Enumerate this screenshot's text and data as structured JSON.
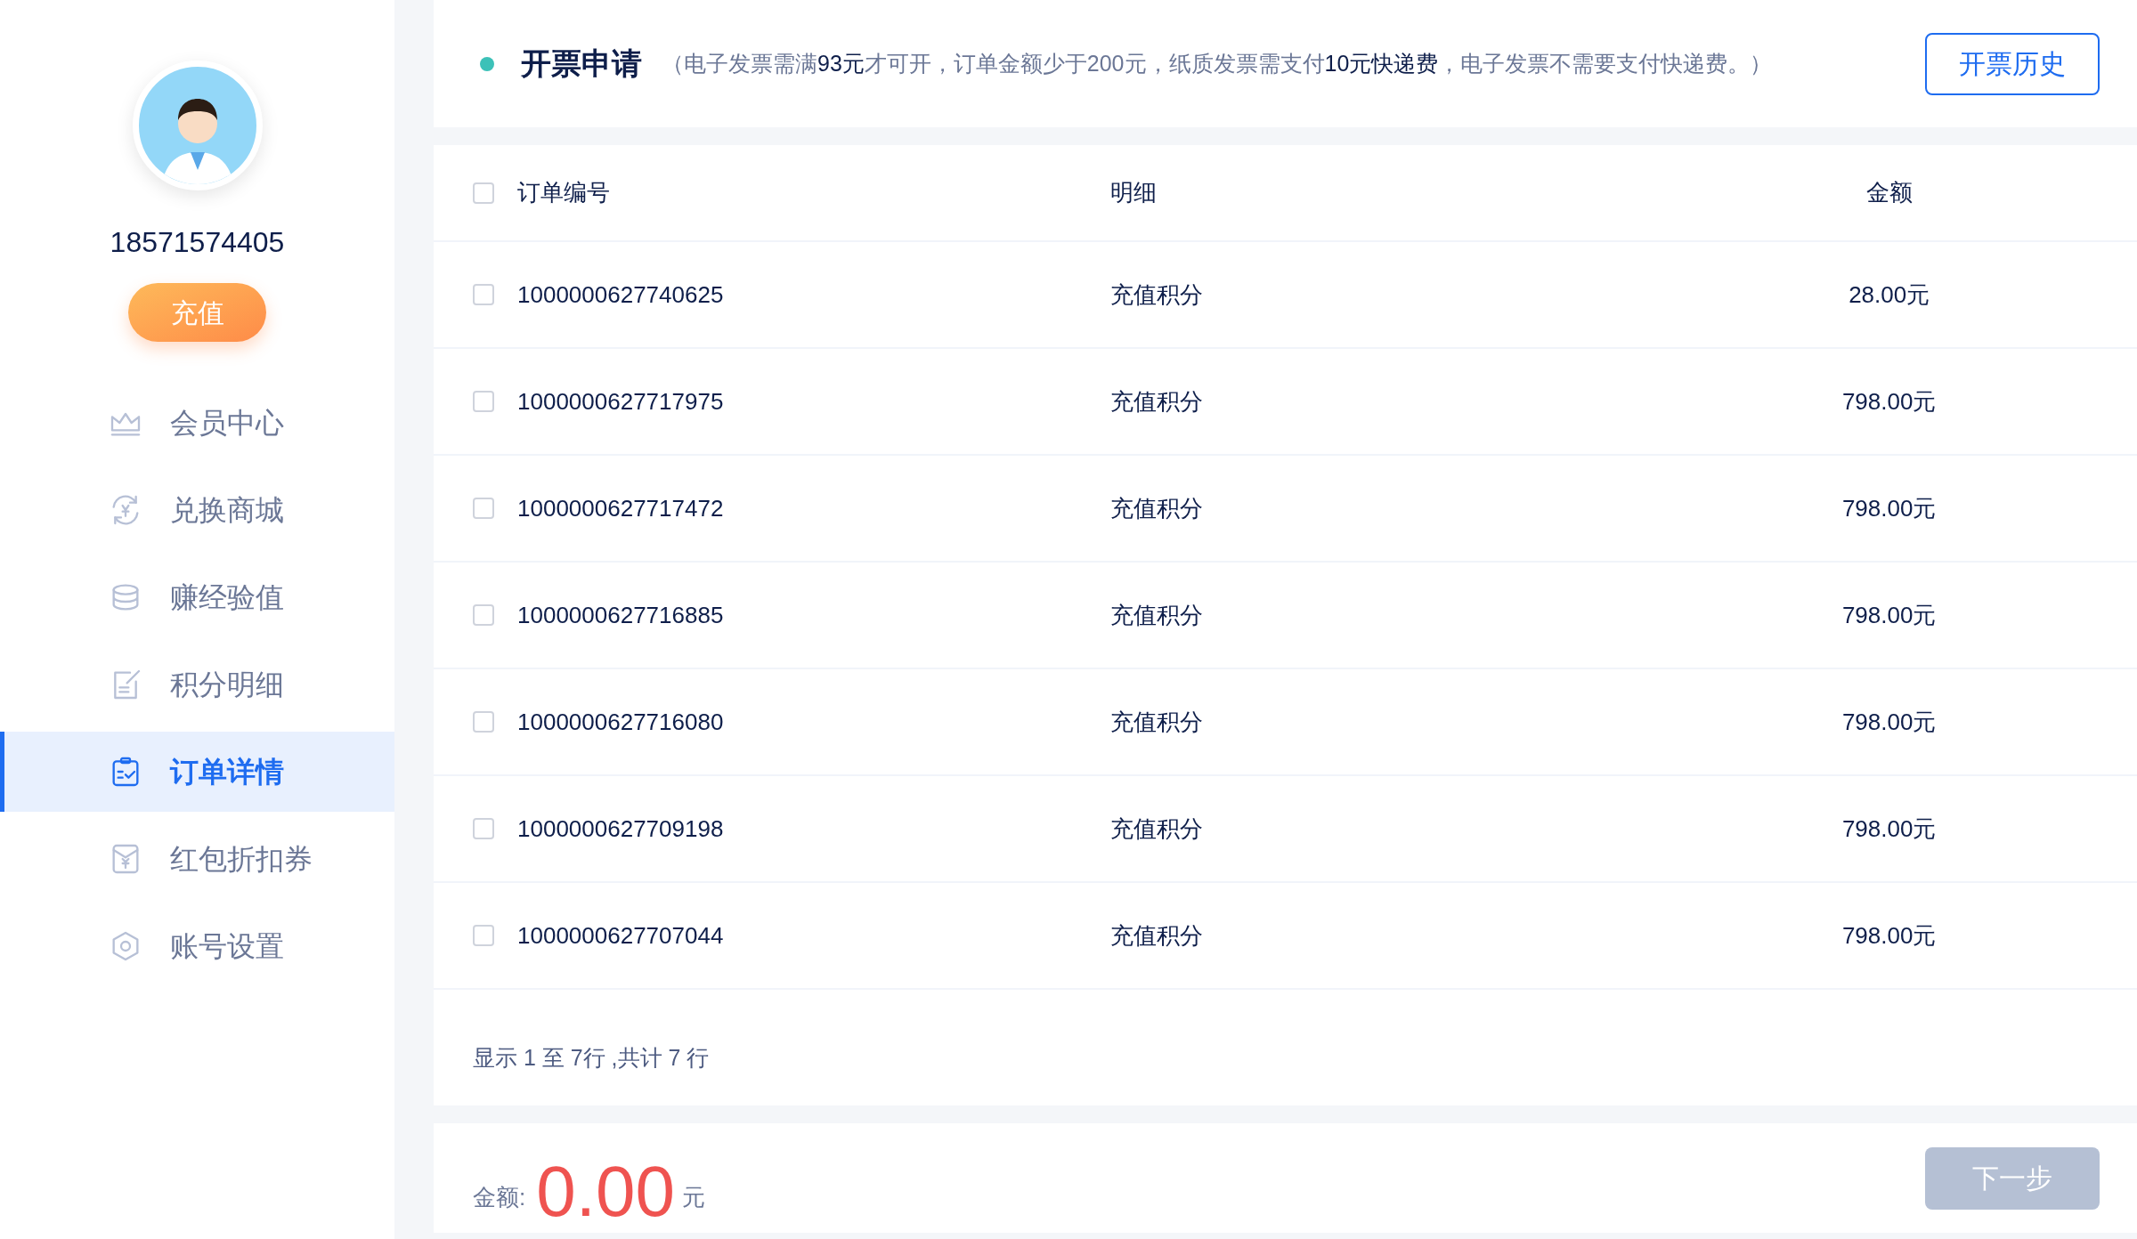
{
  "profile": {
    "phone": "18571574405",
    "recharge_button": "充值"
  },
  "sidebar": {
    "items": [
      {
        "label": "会员中心",
        "selected": false
      },
      {
        "label": "兑换商城",
        "selected": false
      },
      {
        "label": "赚经验值",
        "selected": false
      },
      {
        "label": "积分明细",
        "selected": false
      },
      {
        "label": "订单详情",
        "selected": true
      },
      {
        "label": "红包折扣券",
        "selected": false
      },
      {
        "label": "账号设置",
        "selected": false
      }
    ]
  },
  "header": {
    "title": "开票申请",
    "note": "（电子发票需满**93元**才可开，订单金额少于200元，纸质发票需支付**10元快递费**，电子发票不需要支付快递费。）",
    "history_button": "开票历史"
  },
  "table": {
    "select_all": {
      "checked": false
    },
    "columns": [
      "订单编号",
      "明细",
      "金额"
    ],
    "rows": [
      {
        "checked": false,
        "order_no": "1000000627740625",
        "detail": "充值积分",
        "amount": "28.00元"
      },
      {
        "checked": false,
        "order_no": "1000000627717975",
        "detail": "充值积分",
        "amount": "798.00元"
      },
      {
        "checked": false,
        "order_no": "1000000627717472",
        "detail": "充值积分",
        "amount": "798.00元"
      },
      {
        "checked": false,
        "order_no": "1000000627716885",
        "detail": "充值积分",
        "amount": "798.00元"
      },
      {
        "checked": false,
        "order_no": "1000000627716080",
        "detail": "充值积分",
        "amount": "798.00元"
      },
      {
        "checked": false,
        "order_no": "1000000627709198",
        "detail": "充值积分",
        "amount": "798.00元"
      },
      {
        "checked": false,
        "order_no": "1000000627707044",
        "detail": "充值积分",
        "amount": "798.00元"
      }
    ],
    "pagination": "显示 1 至 7行 ,共计 7 行"
  },
  "footer": {
    "amount_label": "金额:",
    "amount": "0.00",
    "unit": "元",
    "next_button": {
      "label": "下一步",
      "disabled": true
    }
  }
}
